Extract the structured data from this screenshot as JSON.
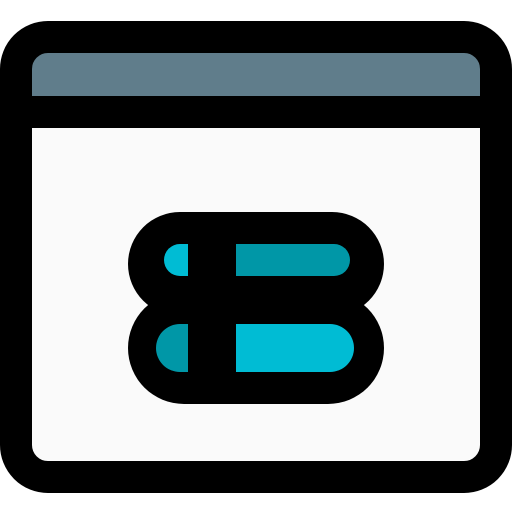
{
  "icon": {
    "name": "browser-window-list-icon",
    "kind": "icon",
    "description_free": true
  },
  "colors": {
    "outline": "#000000",
    "window_body": "#FAFAFA",
    "title_bar": "#607D8B",
    "bar_light": "#00BCD4",
    "bar_dark": "#0097A7"
  }
}
